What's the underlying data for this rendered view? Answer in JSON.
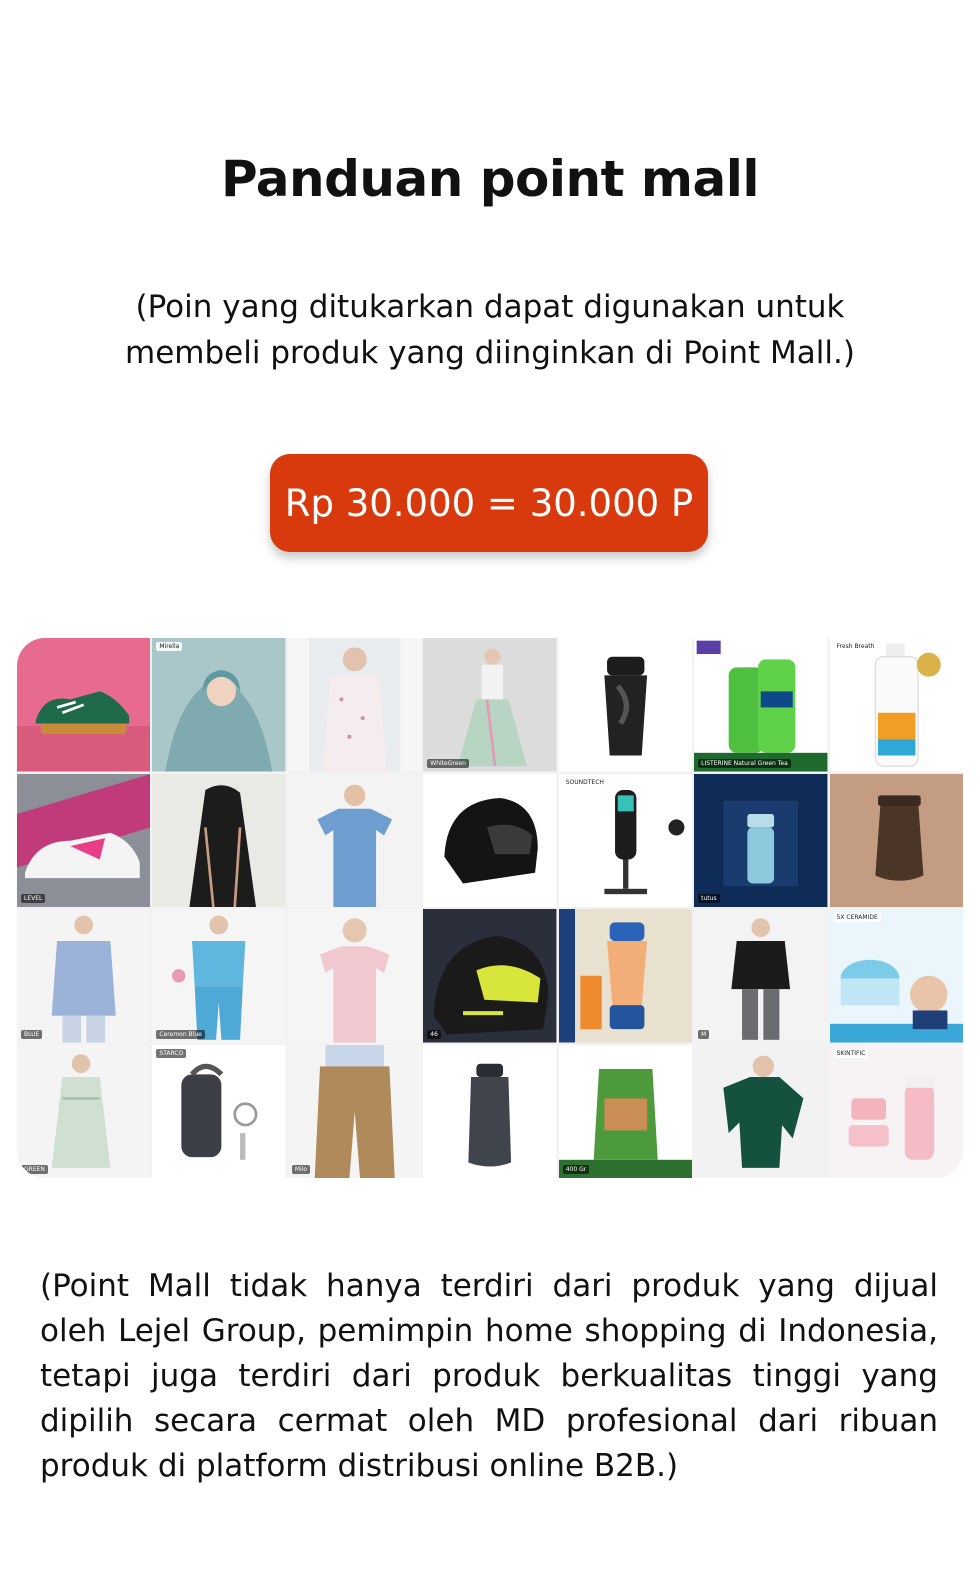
{
  "header": {
    "title": "Panduan point mall",
    "subtitle": "(Poin yang ditukarkan dapat digunakan untuk membeli produk yang diinginkan di Point Mall.)"
  },
  "rate_badge": {
    "text": "Rp 30.000 = 30.000 P",
    "color": "#d93a0d"
  },
  "products": [
    {
      "label": ""
    },
    {
      "label": "Mirella"
    },
    {
      "label": ""
    },
    {
      "label": "WhiteGreen"
    },
    {
      "label": ""
    },
    {
      "label": "LISTERINE Natural Green Tea"
    },
    {
      "label": "Fresh Breath"
    },
    {
      "label": "LEVEL"
    },
    {
      "label": ""
    },
    {
      "label": ""
    },
    {
      "label": ""
    },
    {
      "label": "SOUNDTECH"
    },
    {
      "label": "tutus"
    },
    {
      "label": ""
    },
    {
      "label": "BLUE"
    },
    {
      "label": "Ceremon Blue"
    },
    {
      "label": ""
    },
    {
      "label": "46"
    },
    {
      "label": ""
    },
    {
      "label": "M"
    },
    {
      "label": "5X CERAMIDE"
    },
    {
      "label": "GREEN"
    },
    {
      "label": "STARCO"
    },
    {
      "label": "Milo"
    },
    {
      "label": ""
    },
    {
      "label": "400 Gr"
    },
    {
      "label": ""
    },
    {
      "label": "SKINTIFIC"
    }
  ],
  "footer": {
    "text": "(Point Mall tidak hanya terdiri dari produk yang dijual oleh Lejel Group, pemimpin home shopping di Indonesia, tetapi juga terdiri dari produk berkualitas tinggi yang dipilih secara cermat oleh MD profesional dari ribuan produk di platform distribusi online B2B.)"
  }
}
